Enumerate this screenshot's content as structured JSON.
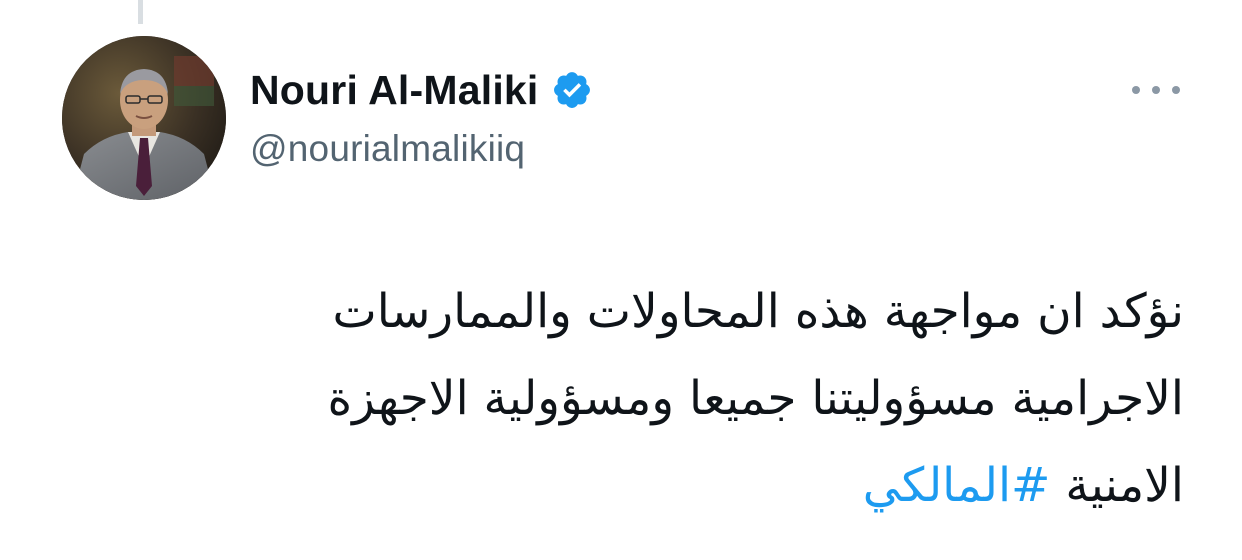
{
  "tweet": {
    "author": {
      "display_name": "Nouri Al-Maliki",
      "handle": "@nourialmalikiiq",
      "verified": true,
      "avatar_icon": "profile-photo"
    },
    "text_lines": [
      "نؤكد ان مواجهة هذه المحاولات والممارسات",
      "الاجرامية مسؤوليتنا جميعا ومسؤولية الاجهزة",
      "الامنية"
    ],
    "hashtag": "#المالكي",
    "more_icon": "more-horizontal-icon"
  },
  "colors": {
    "text_primary": "#0f1419",
    "text_secondary": "#536471",
    "link": "#1d9bf0",
    "verified_badge": "#1d9bf0"
  }
}
